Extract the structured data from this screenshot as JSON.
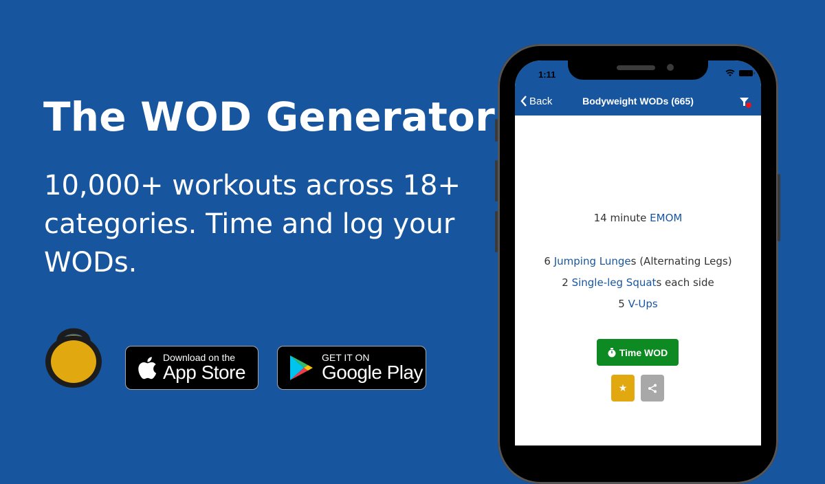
{
  "hero": {
    "title": "The WOD Generator",
    "subtitle_lines": [
      "10,000+ workouts across 18+",
      "categories. Time and log your",
      "WODs."
    ]
  },
  "logo": {
    "icon": "kettlebell-icon",
    "color": "#e2a80f"
  },
  "store_badges": {
    "apple": {
      "small": "Download on the",
      "big": "App Store",
      "icon": "apple-icon"
    },
    "google": {
      "small": "GET IT ON",
      "big": "Google Play",
      "icon": "google-play-icon"
    }
  },
  "phone": {
    "status_bar": {
      "time": "1:11",
      "icons": [
        "signal-icon",
        "wifi-icon",
        "battery-icon"
      ]
    },
    "navbar": {
      "back_label": "Back",
      "title": "Bodyweight WODs (665)",
      "filter_icon": "filter-icon",
      "filter_badge_color": "#e8161b"
    },
    "workout": {
      "format": {
        "prefix": "14 minute ",
        "link": "EMOM"
      },
      "movements": [
        {
          "reps": "6 ",
          "link": "Jumping Lunge",
          "suffix": "s (Alternating Legs)"
        },
        {
          "reps": "2 ",
          "link": "Single-leg Squat",
          "suffix": "s each side"
        },
        {
          "reps": "5 ",
          "link": "V-Ups",
          "suffix": ""
        }
      ]
    },
    "actions": {
      "time_label": "Time WOD",
      "time_icon": "stopwatch-icon",
      "favorite_icon": "star-icon",
      "share_icon": "share-icon"
    }
  },
  "colors": {
    "background": "#17569f",
    "link": "#17569f",
    "time_button": "#0d8a21",
    "favorite_button": "#e2a80f",
    "share_button": "#a8a8a8"
  }
}
